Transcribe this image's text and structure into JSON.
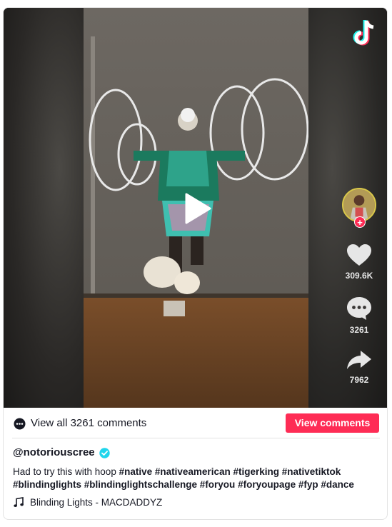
{
  "video": {
    "likes": "309.6K",
    "comments": "3261",
    "shares": "7962"
  },
  "comments_bar": {
    "view_all_label": "View all 3261 comments",
    "view_comments_button": "View comments"
  },
  "post": {
    "username": "@notoriouscree",
    "caption_text": "Had to try this with hoop",
    "hashtags": [
      "#native",
      "#nativeamerican",
      "#tigerking",
      "#nativetiktok",
      "#blindinglights",
      "#blindinglightschallenge",
      "#foryou",
      "#foryoupage",
      "#fyp",
      "#dance"
    ],
    "music": "Blinding Lights - MACDADDYZ"
  },
  "icons": {
    "brand": "tiktok-logo",
    "play": "play-icon",
    "like": "heart-icon",
    "comment": "comment-bubble-icon",
    "share": "share-arrow-icon",
    "verified": "verified-check-icon",
    "music": "music-note-icon"
  },
  "colors": {
    "accent": "#fe2c55",
    "verified": "#20d5ec",
    "text": "#161823"
  }
}
